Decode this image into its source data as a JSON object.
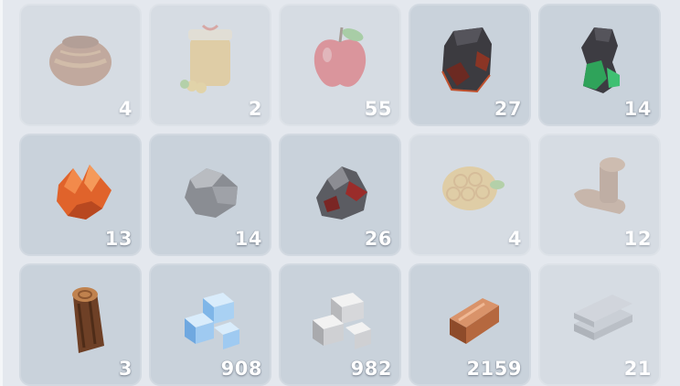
{
  "inventory": {
    "slots": [
      {
        "item": "clay-pot",
        "count": "4",
        "dimmed": true
      },
      {
        "item": "honey-jar",
        "count": "2",
        "dimmed": true
      },
      {
        "item": "apple",
        "count": "55",
        "dimmed": true
      },
      {
        "item": "dark-ore",
        "count": "27",
        "dimmed": false
      },
      {
        "item": "green-ore",
        "count": "14",
        "dimmed": false
      },
      {
        "item": "copper-ore",
        "count": "13",
        "dimmed": false
      },
      {
        "item": "stone",
        "count": "14",
        "dimmed": false
      },
      {
        "item": "iron-ore",
        "count": "26",
        "dimmed": false
      },
      {
        "item": "honeycomb",
        "count": "4",
        "dimmed": true
      },
      {
        "item": "mushroom-wood",
        "count": "12",
        "dimmed": true
      },
      {
        "item": "wood-log",
        "count": "3",
        "dimmed": false
      },
      {
        "item": "ice-blocks",
        "count": "908",
        "dimmed": false
      },
      {
        "item": "stone-blocks",
        "count": "982",
        "dimmed": false
      },
      {
        "item": "copper-ingot",
        "count": "2159",
        "dimmed": false
      },
      {
        "item": "metal-sheets",
        "count": "21",
        "dimmed": true
      }
    ]
  }
}
